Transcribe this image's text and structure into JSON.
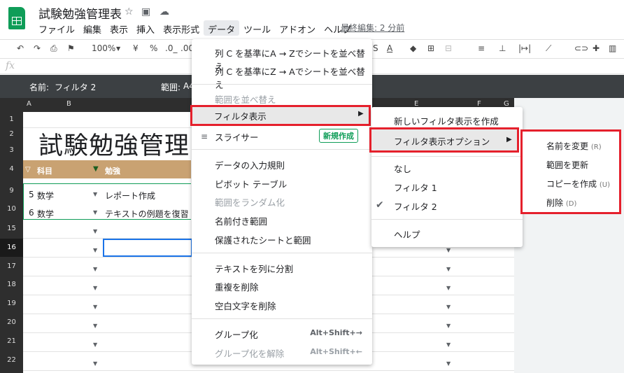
{
  "doc": {
    "title": "試験勉強管理表",
    "last_edit": "最終編集: 2 分前"
  },
  "menubar": [
    "ファイル",
    "編集",
    "表示",
    "挿入",
    "表示形式",
    "データ",
    "ツール",
    "アドオン",
    "ヘルプ"
  ],
  "toolbar": {
    "zoom": "100%",
    "yen": "¥",
    "pct": "%",
    "dec1": ".0_",
    "dec2": ".00"
  },
  "formula": {
    "fx": "fx"
  },
  "filterbar": {
    "name_label": "名前:",
    "name": "フィルタ 2",
    "range_label": "範囲:",
    "range": "A4"
  },
  "columns": [
    "A",
    "B",
    "E",
    "F",
    "G"
  ],
  "rows": [
    "1",
    "2",
    "3",
    "4",
    "9",
    "10",
    "15",
    "16",
    "17",
    "18",
    "19",
    "20",
    "21",
    "22"
  ],
  "sheet": {
    "big_title": "試験勉強管理",
    "header": {
      "subject": "科目",
      "study": "勉強"
    },
    "r9": {
      "num": "5",
      "subject": "数学",
      "task": "レポート作成"
    },
    "r10": {
      "num": "6",
      "subject": "数学",
      "task": "テキストの例題を復習"
    }
  },
  "data_menu": {
    "sort_az": "列 C を基準にA → Zでシートを並べ替え",
    "sort_za": "列 C を基準にZ → Aでシートを並べ替え",
    "sort_range": "範囲を並べ替え",
    "filter_view": "フィルタ表示",
    "slicer": "スライサー",
    "new_badge": "新規作成",
    "validation": "データの入力規則",
    "pivot": "ピボット テーブル",
    "randomize": "範囲をランダム化",
    "named_ranges": "名前付き範囲",
    "protected": "保護されたシートと範囲",
    "split": "テキストを列に分割",
    "dedupe": "重複を削除",
    "trim": "空白文字を削除",
    "group": "グループ化",
    "group_sc": "Alt+Shift+→",
    "ungroup": "グループ化を解除",
    "ungroup_sc": "Alt+Shift+←"
  },
  "filter_submenu": {
    "create": "新しいフィルタ表示を作成",
    "options": "フィルタ表示オプション",
    "none": "なし",
    "filter1": "フィルタ 1",
    "filter2": "フィルタ 2",
    "help": "ヘルプ"
  },
  "options_submenu": {
    "rename": "名前を変更",
    "rename_k": "(R)",
    "update_range": "範囲を更新",
    "duplicate": "コピーを作成",
    "duplicate_k": "(U)",
    "delete": "削除",
    "delete_k": "(D)"
  },
  "colors": {
    "highlight": "#e5202c",
    "header": "#c9a272",
    "sheets_green": "#0f9d58"
  }
}
